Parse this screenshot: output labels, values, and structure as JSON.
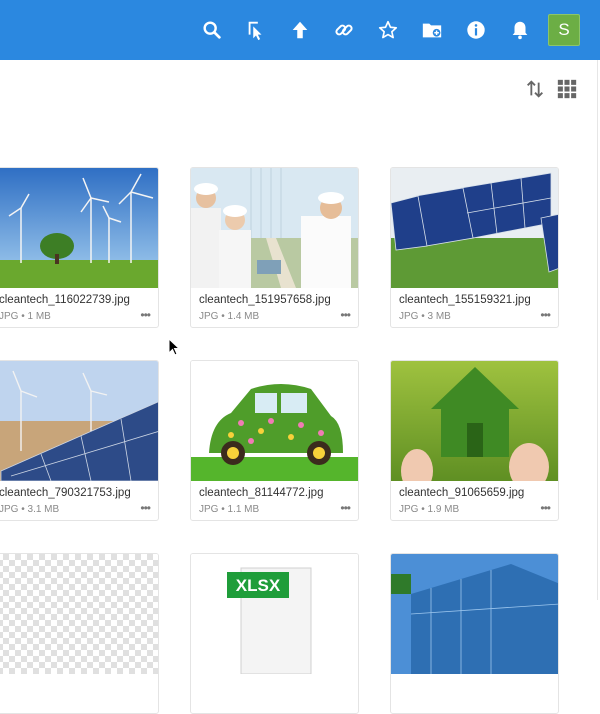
{
  "header": {
    "icons": [
      "search-icon",
      "select-icon",
      "upload-icon",
      "link-icon",
      "star-icon",
      "new-folder-icon",
      "info-icon",
      "bell-icon"
    ],
    "avatar_letter": "S",
    "accent": "#2b88e0",
    "avatar_color": "#6cae45"
  },
  "toolbar": {
    "icons": [
      "sort-icon",
      "grid-view-icon"
    ]
  },
  "files": [
    {
      "name": "cleantech_116022739.jpg",
      "meta": "JPG • 1 MB",
      "more": "•••"
    },
    {
      "name": "cleantech_151957658.jpg",
      "meta": "JPG • 1.4 MB",
      "more": "•••"
    },
    {
      "name": "cleantech_155159321.jpg",
      "meta": "JPG • 3 MB",
      "more": "•••"
    },
    {
      "name": "cleantech_790321753.jpg",
      "meta": "JPG • 3.1 MB",
      "more": "•••"
    },
    {
      "name": "cleantech_81144772.jpg",
      "meta": "JPG • 1.1 MB",
      "more": "•••"
    },
    {
      "name": "cleantech_91065659.jpg",
      "meta": "JPG • 1.9 MB",
      "more": "•••"
    },
    {
      "name": "",
      "meta": "",
      "more": ""
    },
    {
      "name": "",
      "meta": "",
      "more": "",
      "thumb_label": "XLSX"
    },
    {
      "name": "",
      "meta": "",
      "more": ""
    }
  ]
}
